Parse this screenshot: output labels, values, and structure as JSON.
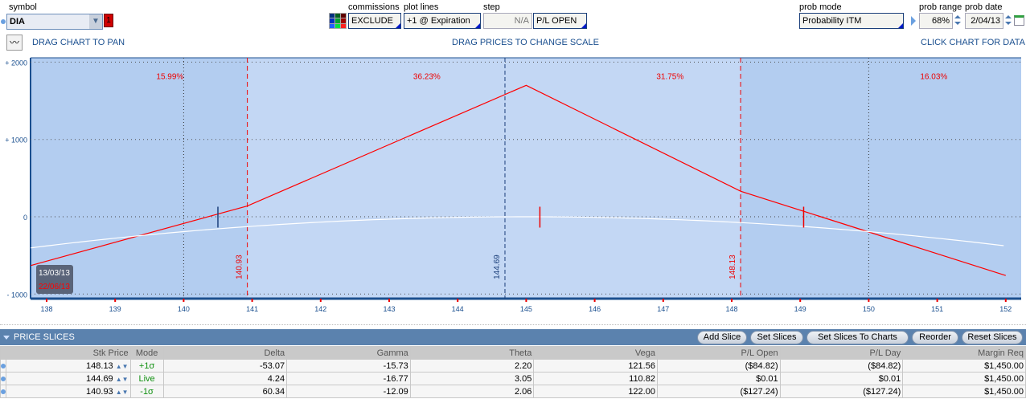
{
  "header": {
    "symbol_label": "symbol",
    "symbol_value": "DIA",
    "symbol_badge": "1",
    "commissions_label": "commissions",
    "commissions_value": "EXCLUDE",
    "plot_lines_label": "plot lines",
    "plot_lines_value": "+1 @ Expiration",
    "step_label": "step",
    "step_value": "N/A",
    "pl_value": "P/L OPEN",
    "prob_mode_label": "prob mode",
    "prob_mode_value": "Probability ITM",
    "prob_range_label": "prob range",
    "prob_range_value": "68%",
    "prob_date_label": "prob date",
    "prob_date_value": "2/04/13"
  },
  "hints": {
    "pan": "DRAG CHART TO PAN",
    "scale": "DRAG PRICES TO CHANGE SCALE",
    "data": "CLICK CHART FOR DATA"
  },
  "chart_data": {
    "type": "line",
    "xlim": [
      137.77,
      152.05
    ],
    "ylim": [
      -1000,
      2000
    ],
    "x_ticks": [
      "138",
      "139",
      "140",
      "141",
      "142",
      "143",
      "144",
      "145",
      "146",
      "147",
      "148",
      "149",
      "150",
      "151",
      "152"
    ],
    "y_ticks": [
      "+ 2000",
      "+ 1000",
      "0",
      "- 1000"
    ],
    "probabilities": [
      "15.99%",
      "36.23%",
      "31.75%",
      "16.03%"
    ],
    "slice_labels": [
      "140.93",
      "144.69",
      "148.13"
    ],
    "series": [
      {
        "name": "expiration",
        "color": "#ff0000",
        "x": [
          137.77,
          140.93,
          145,
          148.13,
          152
        ],
        "y": [
          -630,
          140,
          1700,
          330,
          -760
        ]
      },
      {
        "name": "today",
        "color": "#ffffff",
        "x": [
          137.77,
          139,
          140,
          141,
          142,
          143,
          144,
          145,
          146,
          147,
          148,
          149,
          150,
          151,
          152
        ],
        "y": [
          -360,
          -270,
          -190,
          -120,
          -60,
          -20,
          0,
          5,
          0,
          -20,
          -60,
          -130,
          -210,
          -290,
          -380
        ]
      }
    ],
    "dates": [
      "13/03/13",
      "22/06/13"
    ]
  },
  "slices": {
    "title": "PRICE SLICES",
    "buttons": [
      "Add Slice",
      "Set Slices",
      "Set Slices To Charts",
      "Reorder",
      "Reset Slices"
    ],
    "columns": [
      "Stk Price",
      "Mode",
      "Delta",
      "Gamma",
      "Theta",
      "Vega",
      "P/L Open",
      "P/L Day",
      "Margin Req"
    ],
    "rows": [
      [
        "148.13",
        "+1σ",
        "-53.07",
        "-15.73",
        "2.20",
        "121.56",
        "($84.82)",
        "($84.82)",
        "$1,450.00"
      ],
      [
        "144.69",
        "Live",
        "4.24",
        "-16.77",
        "3.05",
        "110.82",
        "$0.01",
        "$0.01",
        "$1,450.00"
      ],
      [
        "140.93",
        "-1σ",
        "60.34",
        "-12.09",
        "2.06",
        "122.00",
        "($127.24)",
        "($127.24)",
        "$1,450.00"
      ]
    ]
  }
}
